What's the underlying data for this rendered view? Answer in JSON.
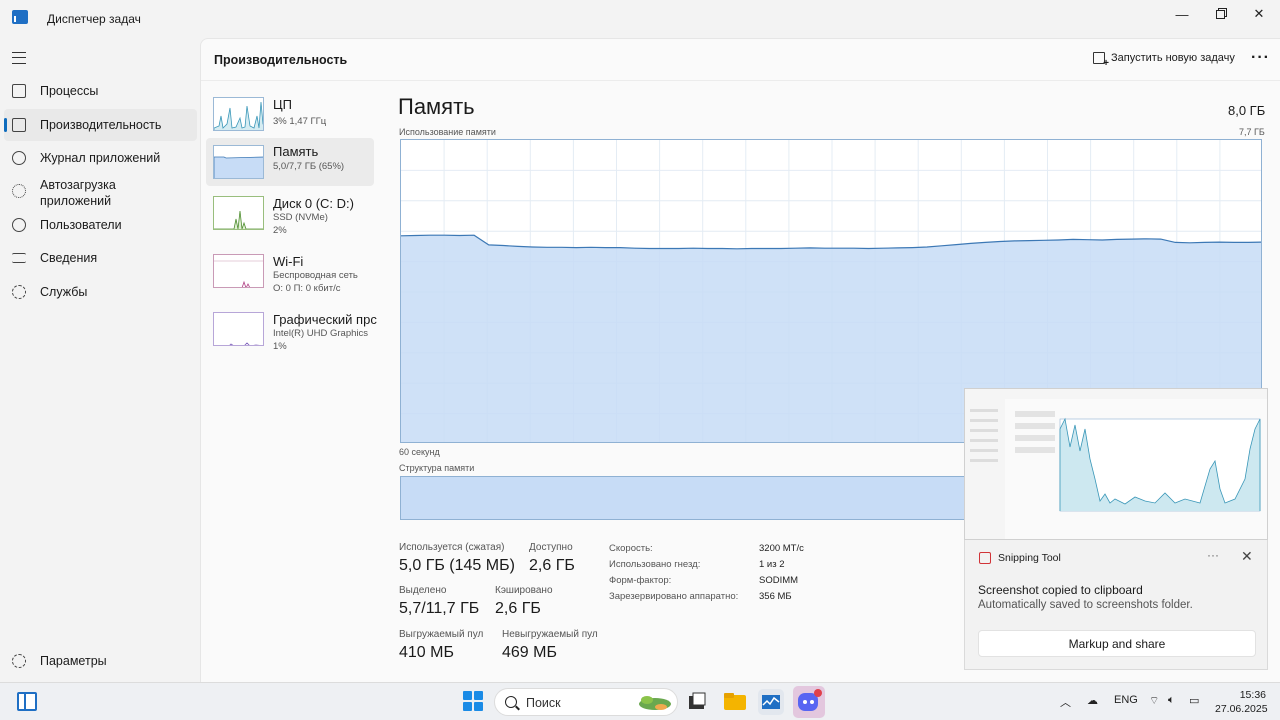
{
  "window": {
    "title": "Диспетчер задач"
  },
  "sidebar": {
    "items": [
      {
        "label": "Процессы",
        "icon": "processes-icon"
      },
      {
        "label": "Производительность",
        "icon": "performance-icon",
        "active": true
      },
      {
        "label": "Журнал приложений",
        "icon": "app-history-icon"
      },
      {
        "label": "Автозагрузка приложений",
        "icon": "startup-icon"
      },
      {
        "label": "Пользователи",
        "icon": "users-icon"
      },
      {
        "label": "Сведения",
        "icon": "details-icon"
      },
      {
        "label": "Службы",
        "icon": "services-icon"
      }
    ],
    "settings_label": "Параметры"
  },
  "header": {
    "title": "Производительность",
    "run_task_label": "Запустить новую задачу"
  },
  "perf_list": [
    {
      "name": "ЦП",
      "sub1": "3% 1,47 ГГц",
      "sub2": ""
    },
    {
      "name": "Память",
      "sub1": "5,0/7,7 ГБ (65%)",
      "sub2": ""
    },
    {
      "name": "Диск 0 (C: D:)",
      "sub1": "SSD (NVMe)",
      "sub2": "2%"
    },
    {
      "name": "Wi-Fi",
      "sub1": "Беспроводная сеть",
      "sub2": "О: 0 П: 0 кбит/с"
    },
    {
      "name": "Графический прс",
      "sub1": "Intel(R) UHD Graphics",
      "sub2": "1%"
    }
  ],
  "memory": {
    "title": "Память",
    "total": "8,0 ГБ",
    "usage_label": "Использование памяти",
    "usage_max": "7,7 ГБ",
    "time_label": "60 секунд",
    "structure_label": "Структура памяти",
    "stats": {
      "in_use_label": "Используется (сжатая)",
      "in_use_value": "5,0 ГБ (145 МБ)",
      "available_label": "Доступно",
      "available_value": "2,6 ГБ",
      "committed_label": "Выделено",
      "committed_value": "5,7/11,7 ГБ",
      "cached_label": "Кэшировано",
      "cached_value": "2,6 ГБ",
      "paged_label": "Выгружаемый пул",
      "paged_value": "410 МБ",
      "nonpaged_label": "Невыгружаемый пул",
      "nonpaged_value": "469 МБ"
    },
    "specs": [
      {
        "label": "Скорость:",
        "value": "3200 МТ/с"
      },
      {
        "label": "Использовано гнезд:",
        "value": "1 из 2"
      },
      {
        "label": "Форм-фактор:",
        "value": "SODIMM"
      },
      {
        "label": "Зарезервировано аппаратно:",
        "value": "356 МБ"
      }
    ],
    "usage_series_percent": [
      68.5,
      68.6,
      68.7,
      68.7,
      68.6,
      68.7,
      65.5,
      65.3,
      65.0,
      64.8,
      64.7,
      64.7,
      64.6,
      64.7,
      64.6,
      64.6,
      64.4,
      64.3,
      64.3,
      64.3,
      64.4,
      64.3,
      64.3,
      64.2,
      64.3,
      64.3,
      64.3,
      64.4,
      64.5,
      64.4,
      64.4,
      64.4,
      64.3,
      64.4,
      64.5,
      64.6,
      64.8,
      65.2,
      65.6,
      66.0,
      66.3,
      66.6,
      66.8,
      66.9,
      67.0,
      67.1,
      67.3,
      67.2,
      67.1,
      67.3,
      67.4,
      67.5,
      67.4,
      66.3,
      66.2,
      66.3,
      66.4,
      66.3,
      66.3,
      66.4
    ]
  },
  "toast": {
    "app_name": "Snipping Tool",
    "title": "Screenshot copied to clipboard",
    "body": "Automatically saved to screenshots folder.",
    "button": "Markup and share",
    "more": "···",
    "close": "✕"
  },
  "taskbar": {
    "search_placeholder": "Поиск",
    "lang": "ENG",
    "time": "15:36",
    "date": "27.06.2025"
  },
  "colors": {
    "accent": "#0f6cbd",
    "graph_fill": "#c7dcf6",
    "graph_line": "#3c78b5"
  }
}
